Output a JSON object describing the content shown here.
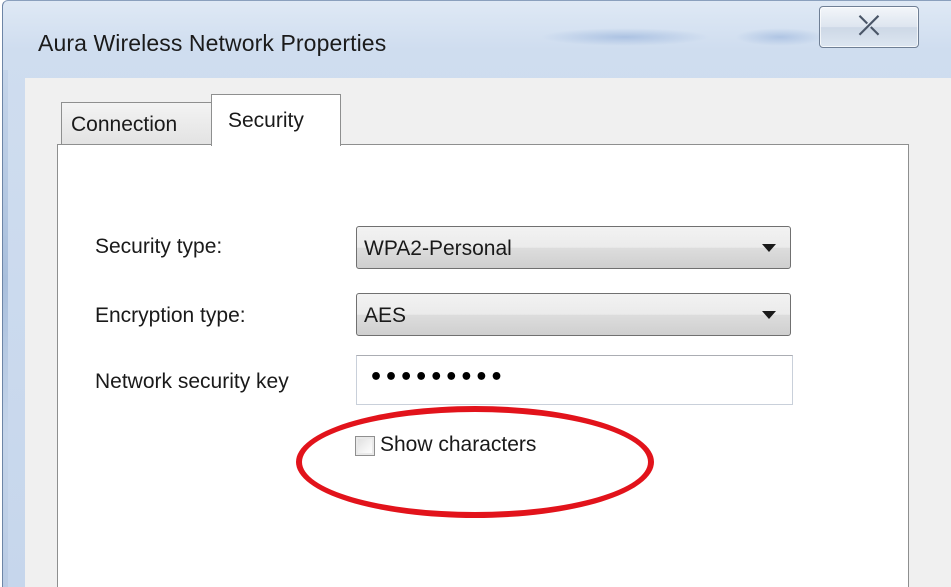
{
  "window": {
    "title": "Aura Wireless Network Properties",
    "close_glyph": "⤫"
  },
  "tabs": [
    {
      "label": "Connection",
      "selected": false
    },
    {
      "label": "Security",
      "selected": true
    }
  ],
  "security": {
    "security_type_label": "Security type:",
    "security_type_value": "WPA2-Personal",
    "encryption_type_label": "Encryption type:",
    "encryption_type_value": "AES",
    "network_key_label": "Network security key",
    "network_key_masked": "•••••••••",
    "show_characters_label": "Show characters",
    "show_characters_checked": false
  },
  "annotation": {
    "highlight_color": "#e2131b",
    "highlight_shape": "ellipse"
  },
  "colors": {
    "window_frame": "#c6d6ec",
    "client_background": "#f0f0f0",
    "tab_page_background": "#ffffff"
  }
}
